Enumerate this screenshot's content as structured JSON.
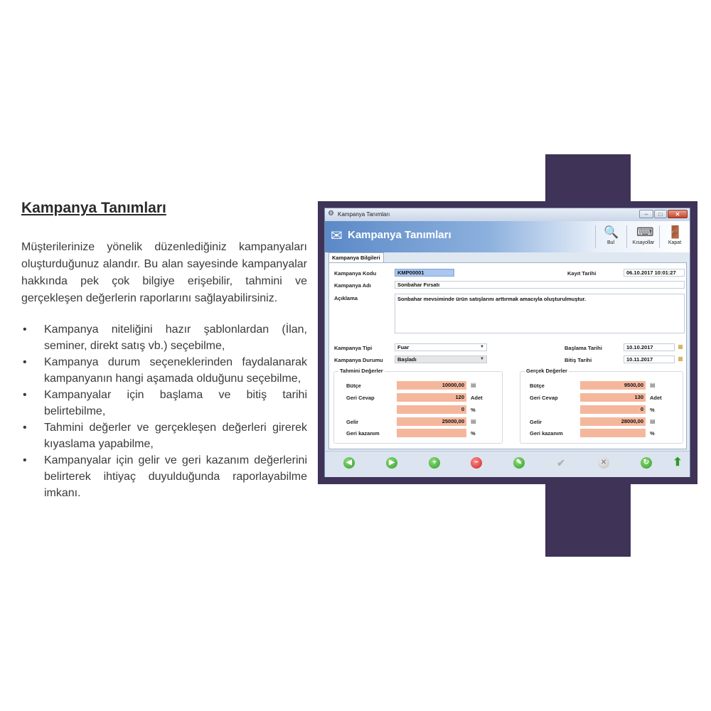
{
  "doc": {
    "heading": "Kampanya Tanımları",
    "intro": "Müşterilerinize yönelik düzenlediğiniz kampanyaları oluşturduğunuz alandır. Bu alan sayesinde kampanyalar hakkında pek çok bilgiye erişebilir, tahmini ve gerçekleşen değerlerin raporlarını sağlayabilirsiniz.",
    "bullet_symbol": "•",
    "bullets": [
      "Kampanya niteliğini hazır şablonlardan (İlan, seminer, direkt satış vb.) seçebilme,",
      "Kampanya durum seçeneklerinden faydalanarak kampanyanın hangi aşamada olduğunu seçebilme,",
      "Kampanyalar için başlama ve bitiş tarihi belirtebilme,",
      "Tahmini değerler ve gerçekleşen değerleri girerek kıyaslama yapabilme,",
      "Kampanyalar için gelir ve geri kazanım değerlerini belirterek ihtiyaç duyulduğunda raporlayabilme imkanı."
    ]
  },
  "window": {
    "title": "Kampanya Tanımları",
    "header_title": "Kampanya Tanımları",
    "controls": {
      "minimize": "–",
      "maximize": "□",
      "close": "✕"
    },
    "toolbar": {
      "find_label": "Bul",
      "shortcuts_label": "Kısayollar",
      "close_label": "Kapat"
    },
    "tab": "Kampanya Bilgileri",
    "form": {
      "code_label": "Kampanya Kodu",
      "code_value": "KMP00001",
      "record_date_label": "Kayıt Tarihi",
      "record_date_value": "06.10.2017 10:01:27",
      "name_label": "Kampanya Adı",
      "name_value": "Sonbahar Fırsatı",
      "desc_label": "Açıklama",
      "desc_value": "Sonbahar mevsiminde ürün satışlarını arttırmak amacıyla oluşturulmuştur.",
      "type_label": "Kampanya Tipi",
      "type_value": "Fuar",
      "status_label": "Kampanya Durumu",
      "status_value": "Başladı",
      "start_label": "Başlama Tarihi",
      "start_value": "10.10.2017",
      "end_label": "Bitiş Tarihi",
      "end_value": "10.11.2017"
    },
    "estimated": {
      "title": "Tahmini Değerler",
      "budget_label": "Bütçe",
      "budget_value": "10000,00",
      "response_label": "Geri Cevap",
      "response_value": "120",
      "response_unit": "Adet",
      "percent_value": "0",
      "percent_unit": "%",
      "income_label": "Gelir",
      "income_value": "25000,00",
      "recovery_label": "Geri kazanım",
      "recovery_value": "",
      "recovery_unit": "%"
    },
    "actual": {
      "title": "Gerçek Değerler",
      "budget_label": "Bütçe",
      "budget_value": "9500,00",
      "response_label": "Geri Cevap",
      "response_value": "130",
      "response_unit": "Adet",
      "percent_value": "0",
      "percent_unit": "%",
      "income_label": "Gelir",
      "income_value": "28000,00",
      "recovery_label": "Geri kazanım",
      "recovery_value": "",
      "recovery_unit": "%"
    }
  },
  "colors": {
    "purple": "#3f3358",
    "numeric_field": "#f5b79c",
    "selected_field": "#a9c7ef",
    "header_blue": "#5b89c7"
  }
}
